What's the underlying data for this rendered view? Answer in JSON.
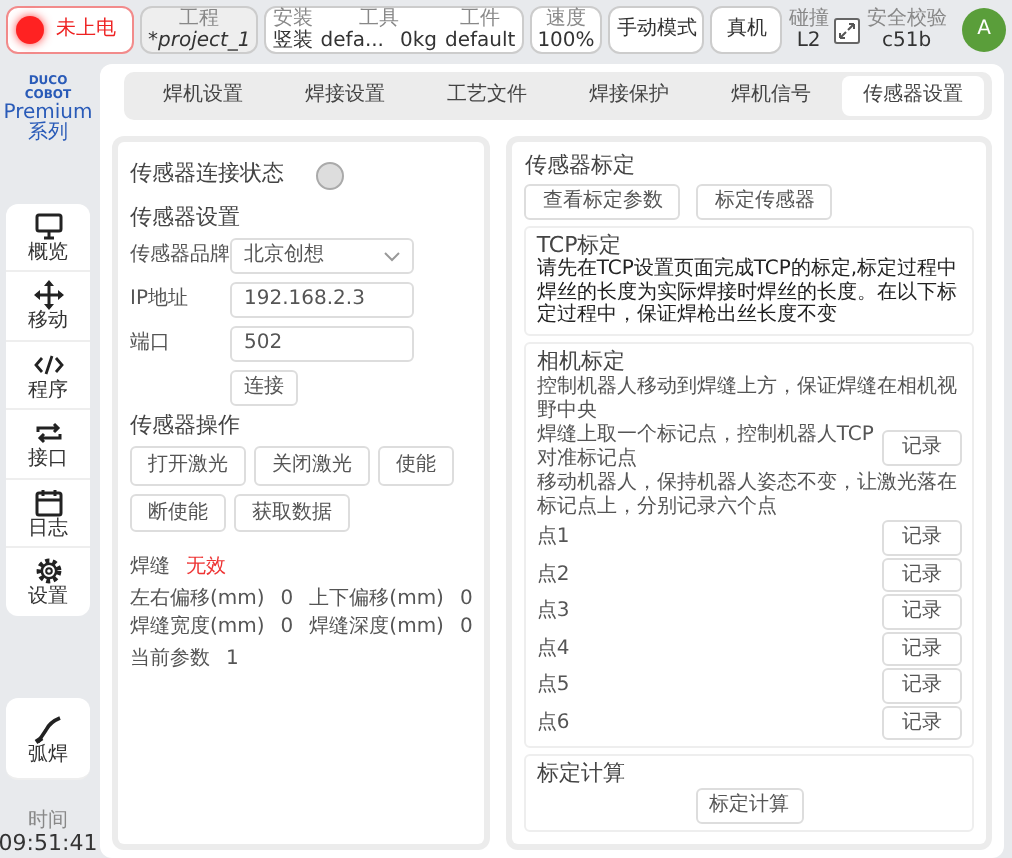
{
  "topbar": {
    "power": {
      "label": "未上电",
      "on": false
    },
    "project": {
      "label": "工程",
      "value": "*project_1"
    },
    "mount": {
      "label": "安装",
      "value": "竖装"
    },
    "tool": {
      "label": "工具",
      "value": "defa...",
      "load": "0kg"
    },
    "workpiece": {
      "label": "工件",
      "value": "default"
    },
    "speed": {
      "label": "速度",
      "value": "100%"
    },
    "mode": "手动模式",
    "machine": "真机",
    "collision": {
      "label": "碰撞",
      "value": "L2"
    },
    "safety": {
      "label": "安全校验",
      "value": "c51b"
    },
    "avatar": "A"
  },
  "sidebar": {
    "logo": "DUCO COBOT",
    "series": "Premium 系列",
    "items": [
      {
        "label": "概览"
      },
      {
        "label": "移动"
      },
      {
        "label": "程序"
      },
      {
        "label": "接口"
      },
      {
        "label": "日志"
      },
      {
        "label": "设置"
      }
    ],
    "weld": "弧焊",
    "time_label": "时间",
    "time": "09:51:41"
  },
  "tabs": [
    {
      "label": "焊机设置",
      "selected": false
    },
    {
      "label": "焊接设置",
      "selected": false
    },
    {
      "label": "工艺文件",
      "selected": false
    },
    {
      "label": "焊接保护",
      "selected": false
    },
    {
      "label": "焊机信号",
      "selected": false
    },
    {
      "label": "传感器设置",
      "selected": true
    }
  ],
  "sensor": {
    "status_label": "传感器连接状态",
    "connected": false,
    "settings_title": "传感器设置",
    "fields": [
      {
        "label": "传感器品牌",
        "value": "北京创想",
        "kind": "select"
      },
      {
        "label": "IP地址",
        "value": "192.168.2.3",
        "kind": "input"
      },
      {
        "label": "端口",
        "value": "502",
        "kind": "input"
      }
    ],
    "connect": "连接",
    "ops_title": "传感器操作",
    "ops": [
      "打开激光",
      "关闭激光",
      "使能",
      "断使能",
      "获取数据"
    ],
    "seam_label": "焊缝",
    "seam_value": "无效",
    "seam_valid": false,
    "readings": [
      {
        "label": "左右偏移(mm)",
        "value": "0"
      },
      {
        "label": "上下偏移(mm)",
        "value": "0"
      },
      {
        "label": "焊缝宽度(mm)",
        "value": "0"
      },
      {
        "label": "焊缝深度(mm)",
        "value": "0"
      }
    ],
    "param_label": "当前参数",
    "param_value": "1"
  },
  "calibration": {
    "title": "传感器标定",
    "buttons": [
      "查看标定参数",
      "标定传感器"
    ],
    "tcp": {
      "title": "TCP标定",
      "text": "请先在TCP设置页面完成TCP的标定,标定过程中焊丝的长度为实际焊接时焊丝的长度。在以下标定过程中，保证焊枪出丝长度不变"
    },
    "camera": {
      "title": "相机标定",
      "text": "控制机器人移动到焊缝上方，保证焊缝在相机视野中央",
      "mark_text": "焊缝上取一个标记点，控制机器人TCP对准标记点",
      "mark_button": "记录",
      "move_text": "移动机器人，保持机器人姿态不变，让激光落在标记点上，分别记录六个点",
      "points": [
        {
          "label": "点1",
          "button": "记录"
        },
        {
          "label": "点2",
          "button": "记录"
        },
        {
          "label": "点3",
          "button": "记录"
        },
        {
          "label": "点4",
          "button": "记录"
        },
        {
          "label": "点5",
          "button": "记录"
        },
        {
          "label": "点6",
          "button": "记录"
        }
      ]
    },
    "compute": {
      "title": "标定计算",
      "button": "标定计算"
    }
  }
}
